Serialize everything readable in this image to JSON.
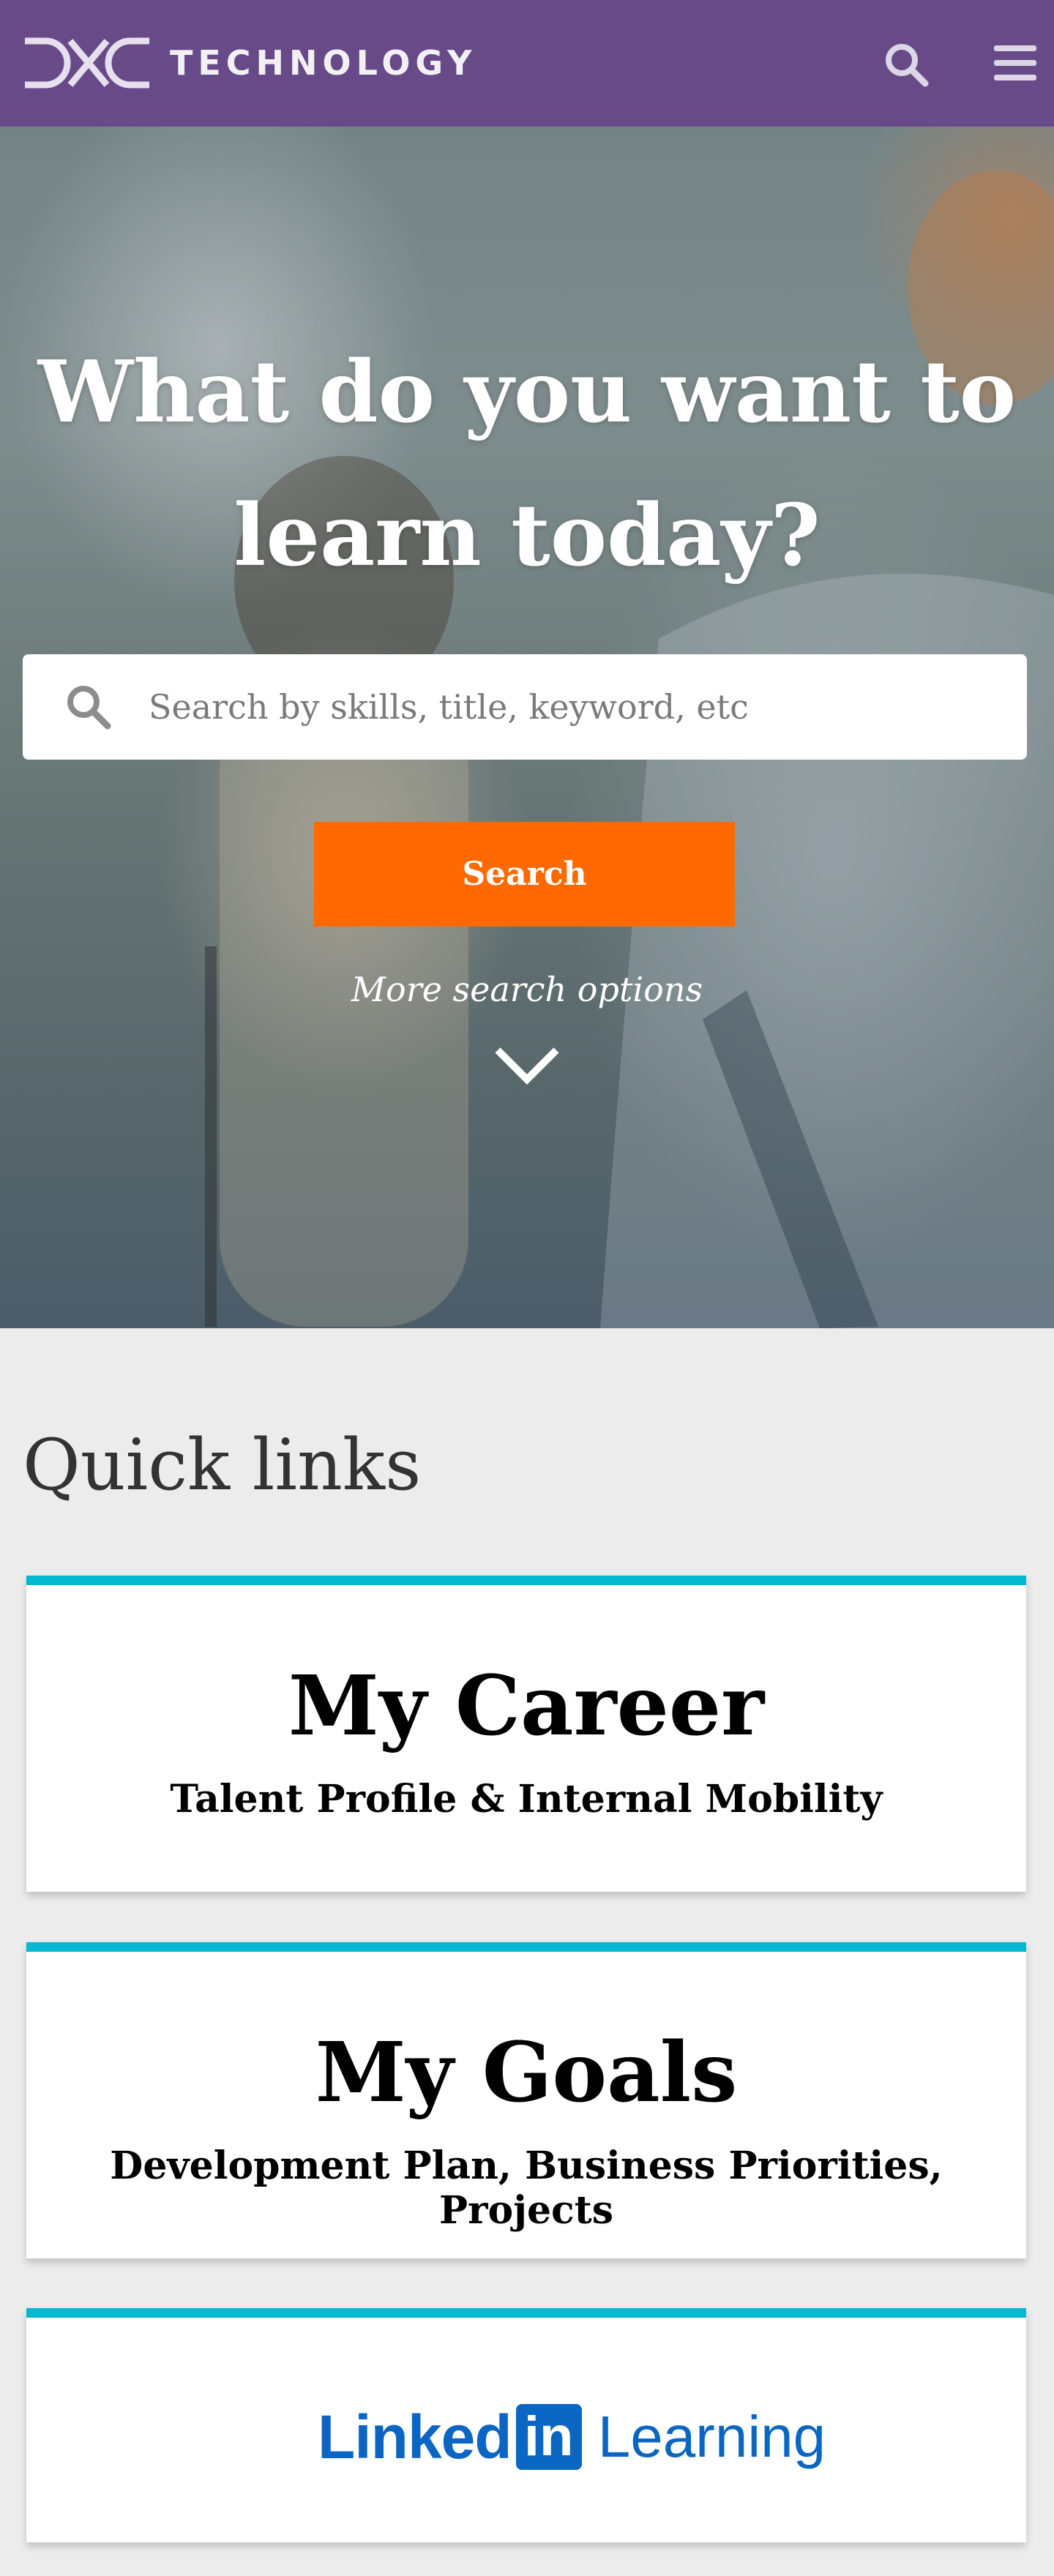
{
  "header": {
    "brand_text": "TECHNOLOGY",
    "logo_mark_text": "DXC",
    "search_icon": "search-icon",
    "menu_icon": "hamburger-menu-icon",
    "background_color": "#684a88"
  },
  "hero": {
    "title": "What do you want to learn today?",
    "search_placeholder": "Search by skills, title, keyword, etc",
    "search_value": "",
    "search_button_label": "Search",
    "more_options_label": "More search options",
    "more_options_icon": "chevron-down-icon",
    "button_color": "#ff6a00"
  },
  "quick_links": {
    "title": "Quick links",
    "accent_color": "#00b9d1",
    "cards": [
      {
        "title": "My Career",
        "subtitle": "Talent Profile & Internal Mobility"
      },
      {
        "title": "My Goals",
        "subtitle": "Development Plan, Business Priorities, Projects"
      },
      {
        "logo_linked": "Linked",
        "logo_in": "in",
        "logo_learning": "Learning"
      }
    ]
  }
}
